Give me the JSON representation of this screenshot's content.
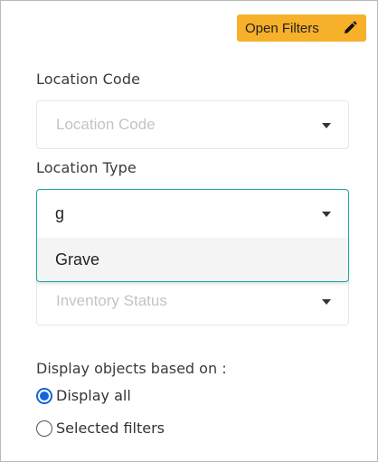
{
  "toolbar": {
    "open_filters_label": "Open Filters",
    "open_filters_icon": "pencil-icon"
  },
  "fields": {
    "location_code": {
      "label": "Location Code",
      "placeholder": "Location Code"
    },
    "location_type": {
      "label": "Location Type",
      "value": "g",
      "options": [
        "Grave"
      ]
    },
    "inventory_status": {
      "placeholder": "Inventory Status"
    }
  },
  "display": {
    "label": "Display objects based on :",
    "options": [
      {
        "label": "Display all",
        "selected": true
      },
      {
        "label": "Selected filters",
        "selected": false
      }
    ]
  },
  "colors": {
    "accent_button": "#f6b02a",
    "focus_border": "#1aa6a6",
    "radio_checked": "#1565d8"
  }
}
